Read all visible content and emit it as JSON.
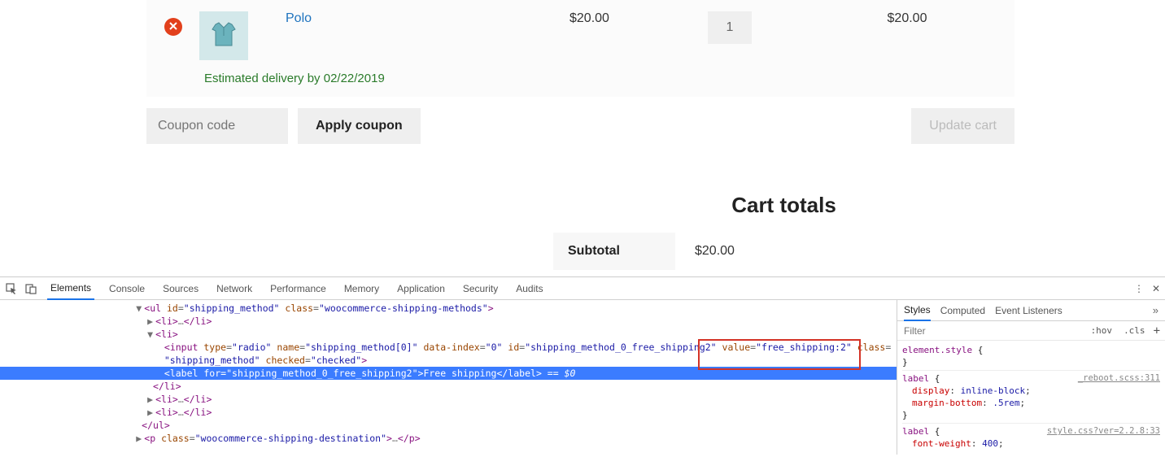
{
  "cart": {
    "item": {
      "name": "Polo",
      "price": "$20.00",
      "qty": "1",
      "subtotal": "$20.00",
      "delivery": "Estimated delivery by 02/22/2019"
    },
    "coupon_placeholder": "Coupon code",
    "apply_label": "Apply coupon",
    "update_label": "Update cart"
  },
  "totals": {
    "title": "Cart totals",
    "subtotal_label": "Subtotal",
    "subtotal_value": "$20.00"
  },
  "devtools": {
    "tabs": [
      "Elements",
      "Console",
      "Sources",
      "Network",
      "Performance",
      "Memory",
      "Application",
      "Security",
      "Audits"
    ],
    "side_tabs": [
      "Styles",
      "Computed",
      "Event Listeners"
    ],
    "filter_placeholder": "Filter",
    "hov": ":hov",
    "cls": ".cls",
    "el_style": "element.style",
    "label_sel": "label",
    "src1": "_reboot.scss:311",
    "src2": "style.css?ver=2.2.8:33",
    "display_prop": "display",
    "display_val": "inline-block",
    "mb_prop": "margin-bottom",
    "mb_val": ".5rem",
    "fw_prop": "font-weight",
    "fw_val": "400",
    "dom": {
      "ul_open": "<ul id=\"shipping_method\" class=\"woocommerce-shipping-methods\">",
      "li_collapsed": "<li>…</li>",
      "li_open": "<li>",
      "input_line_a": "<input type=\"radio\" name=\"shipping_method[0]\" data-index=\"0\" id=\"shipping_method_0_free_shipping2\" value=\"free_shipping:2\" class=",
      "input_line_b": "\"shipping_method\" checked=\"checked\">",
      "label_line": "<label for=\"shipping_method_0_free_shipping2\">Free shipping</label>",
      "eq_meta": " == $0",
      "li_close": "</li>",
      "ul_close": "</ul>",
      "p_line": "<p class=\"woocommerce-shipping-destination\">…</p>"
    }
  }
}
